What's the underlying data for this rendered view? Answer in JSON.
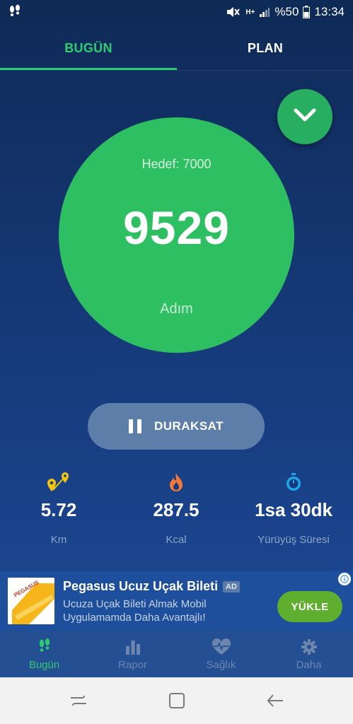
{
  "status_bar": {
    "battery_percent": "%50",
    "time": "13:34",
    "network_type": "H+",
    "icons": [
      "footsteps-icon",
      "mute-icon",
      "signal-icon",
      "battery-icon"
    ]
  },
  "tabs": [
    {
      "label": "BUGÜN",
      "active": true
    },
    {
      "label": "PLAN",
      "active": false
    }
  ],
  "tracker": {
    "goal_text": "Hedef: 7000",
    "steps": "9529",
    "unit": "Adım"
  },
  "pause_button": {
    "label": "DURAKSAT"
  },
  "stats": [
    {
      "icon": "map-pins-icon",
      "value": "5.72",
      "label": "Km"
    },
    {
      "icon": "flame-icon",
      "value": "287.5",
      "label": "Kcal"
    },
    {
      "icon": "stopwatch-icon",
      "value": "1sa 30dk",
      "label": "Yürüyüş Süresi"
    }
  ],
  "ad": {
    "title": "Pegasus Ucuz Uçak Bileti",
    "badge": "AD",
    "description": "Ucuza Uçak Bileti Almak Mobil Uygulamamda Daha Avantajlı!",
    "install_label": "YÜKLE",
    "logo_text": "PEGASUS"
  },
  "bottom_nav": [
    {
      "label": "Bugün",
      "icon": "footsteps-icon",
      "active": true
    },
    {
      "label": "Rapor",
      "icon": "bar-chart-icon",
      "active": false
    },
    {
      "label": "Sağlık",
      "icon": "heart-pulse-icon",
      "active": false
    },
    {
      "label": "Daha",
      "icon": "gear-icon",
      "active": false
    }
  ],
  "colors": {
    "accent": "#2ecc71",
    "circle": "#2ebf63",
    "background_top": "#0e2a56",
    "background_bottom": "#1b4891",
    "ad_button": "#5fae2f"
  }
}
